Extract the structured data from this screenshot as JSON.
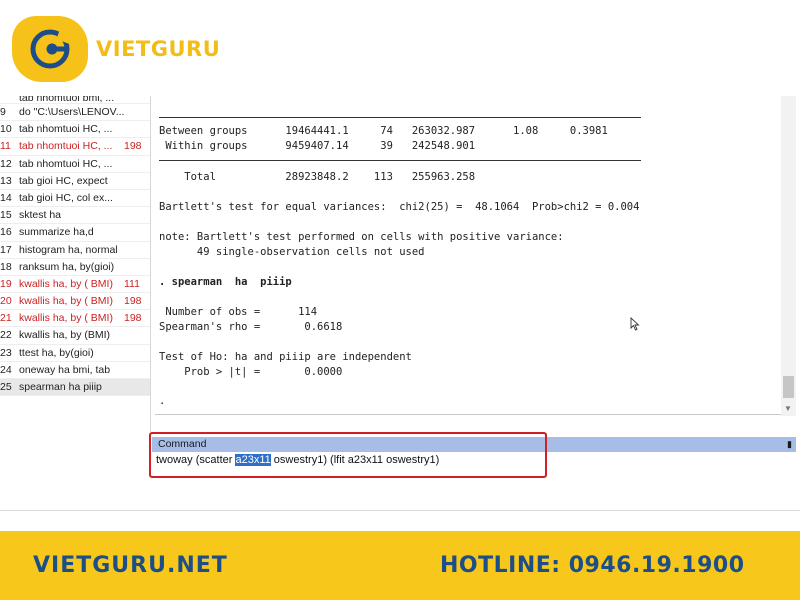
{
  "brand": {
    "name": "VIETGURU",
    "website": "VIETGURU.NET",
    "hotline": "HOTLINE: 0946.19.1900",
    "colors": {
      "yellow": "#f6c21a",
      "navy": "#1d4e87",
      "error_red": "#cc2222",
      "highlight_blue": "#2f6fc8",
      "annotation_red": "#d21f25"
    }
  },
  "review": {
    "items": [
      {
        "num": "",
        "cmd": "tab   nhomtuoi  bmi, ...",
        "rc": "",
        "error": false
      },
      {
        "num": "9",
        "cmd": "do \"C:\\Users\\LENOV...",
        "rc": "",
        "error": false
      },
      {
        "num": "10",
        "cmd": "tab  nhomtuoi  HC, ...",
        "rc": "",
        "error": false
      },
      {
        "num": "11",
        "cmd": "tab  nhomtuoi  HC, ...",
        "rc": "198",
        "error": true
      },
      {
        "num": "12",
        "cmd": "tab  nhomtuoi  HC, ...",
        "rc": "",
        "error": false
      },
      {
        "num": "13",
        "cmd": "tab   gioi HC, expect",
        "rc": "",
        "error": false
      },
      {
        "num": "14",
        "cmd": "tab   gioi HC, col ex...",
        "rc": "",
        "error": false
      },
      {
        "num": "15",
        "cmd": "sktest  ha",
        "rc": "",
        "error": false
      },
      {
        "num": "16",
        "cmd": "summarize ha,d",
        "rc": "",
        "error": false
      },
      {
        "num": "17",
        "cmd": "histogram ha, normal",
        "rc": "",
        "error": false
      },
      {
        "num": "18",
        "cmd": "ranksum ha, by(gioi)",
        "rc": "",
        "error": false
      },
      {
        "num": "19",
        "cmd": "kwallis  ha, by ( BMI)",
        "rc": "111",
        "error": true
      },
      {
        "num": "20",
        "cmd": "kwallis ha, by ( BMI)",
        "rc": "198",
        "error": true
      },
      {
        "num": "21",
        "cmd": "kwallis ha, by ( BMI)",
        "rc": "198",
        "error": true
      },
      {
        "num": "22",
        "cmd": "kwallis ha, by (BMI)",
        "rc": "",
        "error": false
      },
      {
        "num": "23",
        "cmd": "ttest ha, by(gioi)",
        "rc": "",
        "error": false
      },
      {
        "num": "24",
        "cmd": "oneway ha bmi, tab",
        "rc": "",
        "error": false
      },
      {
        "num": "25",
        "cmd": "spearman  ha  piiip",
        "rc": "",
        "error": false,
        "selected": true
      }
    ]
  },
  "results": {
    "lines": [
      {
        "text": "Between groups      19464441.1     74   263032.987      1.08     0.3981",
        "bold": false
      },
      {
        "text": " Within groups      9459407.14     39   242548.901",
        "bold": false
      },
      {
        "text": "    Total           28923848.2    113   255963.258",
        "bold": false
      },
      {
        "text": "Bartlett's test for equal variances:  chi2(25) =  48.1064  Prob>chi2 = 0.004",
        "bold": false
      },
      {
        "text": "note: Bartlett's test performed on cells with positive variance:",
        "bold": false
      },
      {
        "text": "      49 single-observation cells not used",
        "bold": false
      },
      {
        "text": ". spearman  ha  piiip",
        "bold": true
      },
      {
        "text": " Number of obs =      114",
        "bold": false
      },
      {
        "text": "Spearman's rho =       0.6618",
        "bold": false
      },
      {
        "text": "Test of Ho: ha and piiip are independent",
        "bold": false
      },
      {
        "text": "    Prob > |t| =       0.0000",
        "bold": false
      },
      {
        "text": ".",
        "bold": false
      }
    ]
  },
  "command": {
    "header": "Command",
    "text_before": "twoway (scatter ",
    "text_selected": "a23x11",
    "text_after": " oswestry1) (lfit a23x11 oswestry1)"
  }
}
